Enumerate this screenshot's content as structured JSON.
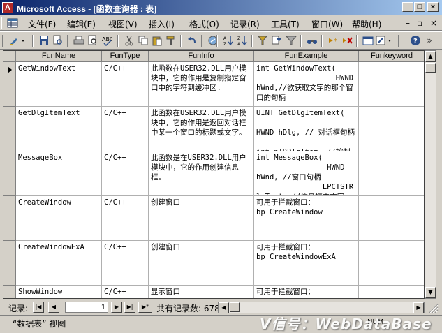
{
  "window": {
    "title": "Microsoft Access - [函数查询器 : 表]"
  },
  "menu": {
    "items": [
      {
        "label": "文件(F)"
      },
      {
        "label": "编辑(E)"
      },
      {
        "label": "视图(V)"
      },
      {
        "label": "插入(I)"
      },
      {
        "label": "格式(O)"
      },
      {
        "label": "记录(R)"
      },
      {
        "label": "工具(T)"
      },
      {
        "label": "窗口(W)"
      },
      {
        "label": "帮助(H)"
      }
    ]
  },
  "table": {
    "columns": [
      "FunName",
      "FunType",
      "FunInfo",
      "FunExample",
      "Funkeyword"
    ],
    "rows": [
      {
        "name": "GetWindowText",
        "type": "C/C++",
        "info": "此函数在USER32.DLL用户模块中，它的作用是复制指定窗口中的字符到缓冲区.",
        "example": "int GetWindowText(\n                  HWND\nhWnd,//欲获取文字的那个窗口的句柄",
        "keyword": ""
      },
      {
        "name": "GetDlgItemText",
        "type": "C/C++",
        "info": "此函数在USER32.DLL用户模块中，它的作用是返回对话框中某一个窗口的标题或文字。",
        "example": "UINT GetDlgItemText(\n\nHWND hDlg, // 对话框句柄\n\nint nIDDlgItem, //控制标",
        "keyword": ""
      },
      {
        "name": "MessageBox",
        "type": "C/C++",
        "info": "此函数是在USER32.DLL用户模块中，它的作用创建信息框。",
        "example": "int MessageBox(\n                HWND\nhWnd, //窗口句柄\n               LPCTSTR\nlpText, //信息框中文字",
        "keyword": ""
      },
      {
        "name": "CreateWindow",
        "type": "C/C++",
        "info": "创建窗口",
        "example": "可用于拦截窗口：\nbp CreateWindow",
        "keyword": ""
      },
      {
        "name": "CreateWindowExA",
        "type": "C/C++",
        "info": "创建窗口",
        "example": "可用于拦截窗口：\nbp CreateWindowExA",
        "keyword": ""
      },
      {
        "name": "ShowWindow",
        "type": "C/C++",
        "info": "显示窗口",
        "example": "可用于拦截窗口：\nbp ShowWindow",
        "keyword": ""
      }
    ]
  },
  "navigation": {
    "label": "记录:",
    "current": "1",
    "total": "共有记录数: 678"
  },
  "status": {
    "view": "“数据表” 视图",
    "mode": "NUM"
  },
  "watermark": "V信号：WebDataBase",
  "colors": {
    "titlebar_start": "#0a246a",
    "titlebar_end": "#a6caf0",
    "chrome": "#d4d0c8"
  },
  "icons": [
    "app-icon",
    "minimize-icon",
    "maximize-icon",
    "close-icon",
    "design-view-icon",
    "save-icon",
    "print-icon",
    "preview-icon",
    "spellcheck-icon",
    "cut-icon",
    "copy-icon",
    "paste-icon",
    "undo-icon",
    "sort-ascending-icon",
    "sort-descending-icon",
    "filter-icon",
    "find-icon",
    "new-record-icon",
    "delete-record-icon",
    "database-window-icon",
    "new-object-icon",
    "help-icon"
  ]
}
